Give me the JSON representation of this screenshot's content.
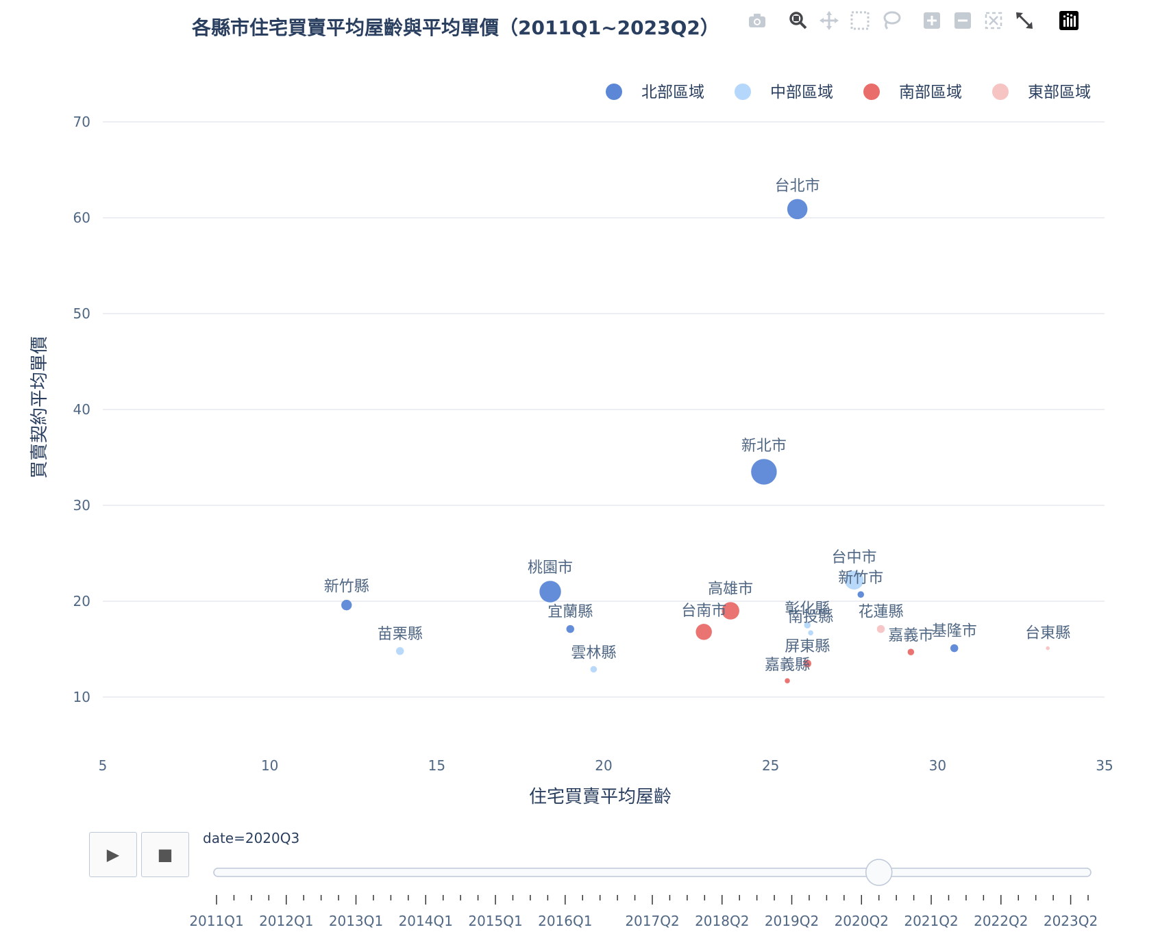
{
  "title": "各縣市住宅買賣平均屋齡與平均單價（2011Q1~2023Q2）",
  "modebar": {
    "icons": [
      "camera-icon",
      "zoom-icon",
      "pan-icon",
      "box-select-icon",
      "lasso-select-icon",
      "zoom-in-icon",
      "zoom-out-icon",
      "autoscale-icon",
      "reset-axes-icon",
      "plotly-logo-icon"
    ]
  },
  "legend": {
    "items": [
      {
        "label": "北部區域",
        "color": "#5b87d6"
      },
      {
        "label": "中部區域",
        "color": "#b5d7fb"
      },
      {
        "label": "南部區域",
        "color": "#e96d6a"
      },
      {
        "label": "東部區域",
        "color": "#f6c4c3"
      }
    ]
  },
  "animation": {
    "current_label": "date=2020Q3",
    "play_label": "▶",
    "stop_label": "■",
    "steps_total": 51,
    "current_step": 38,
    "tick_labels": [
      "2011Q1",
      "2012Q1",
      "2013Q1",
      "2014Q1",
      "2015Q1",
      "2016Q1",
      "2017Q2",
      "2018Q2",
      "2019Q2",
      "2020Q2",
      "2021Q2",
      "2022Q2",
      "2023Q2"
    ],
    "label_steps": [
      0,
      4,
      8,
      12,
      16,
      20,
      25,
      29,
      33,
      37,
      41,
      45,
      49
    ]
  },
  "chart_data": {
    "type": "scatter",
    "title": "各縣市住宅買賣平均屋齡與平均單價（2011Q1~2023Q2）",
    "xlabel": "住宅買賣平均屋齡",
    "ylabel": "買賣契約平均單價",
    "xlim": [
      5,
      35
    ],
    "ylim": [
      4.5,
      72
    ],
    "xticks": [
      5,
      10,
      15,
      20,
      25,
      30,
      35
    ],
    "yticks": [
      10,
      20,
      30,
      40,
      50,
      60,
      70
    ],
    "grid": true,
    "legend_position": "top-right",
    "frame": "2020Q3",
    "series": [
      {
        "name": "北部區域",
        "color": "#5b87d6",
        "points": [
          {
            "label": "台北市",
            "x": 25.8,
            "y": 60.9,
            "size": 15
          },
          {
            "label": "新北市",
            "x": 24.8,
            "y": 33.5,
            "size": 19
          },
          {
            "label": "桃園市",
            "x": 18.4,
            "y": 21.0,
            "size": 16
          },
          {
            "label": "新竹市",
            "x": 27.7,
            "y": 20.7,
            "size": 5
          },
          {
            "label": "新竹縣",
            "x": 12.3,
            "y": 19.6,
            "size": 8
          },
          {
            "label": "宜蘭縣",
            "x": 19.0,
            "y": 17.1,
            "size": 6
          },
          {
            "label": "基隆市",
            "x": 30.5,
            "y": 15.1,
            "size": 6
          }
        ]
      },
      {
        "name": "中部區域",
        "color": "#b5d7fb",
        "points": [
          {
            "label": "台中市",
            "x": 27.5,
            "y": 22.2,
            "size": 14
          },
          {
            "label": "彰化縣",
            "x": 26.1,
            "y": 17.5,
            "size": 5
          },
          {
            "label": "南投縣",
            "x": 26.2,
            "y": 16.7,
            "size": 4
          },
          {
            "label": "苗栗縣",
            "x": 13.9,
            "y": 14.8,
            "size": 6
          },
          {
            "label": "雲林縣",
            "x": 19.7,
            "y": 12.9,
            "size": 5
          }
        ]
      },
      {
        "name": "南部區域",
        "color": "#e96d6a",
        "points": [
          {
            "label": "高雄市",
            "x": 23.8,
            "y": 19.0,
            "size": 13
          },
          {
            "label": "台南市",
            "x": 23.0,
            "y": 16.8,
            "size": 12
          },
          {
            "label": "屏東縣",
            "x": 26.1,
            "y": 13.5,
            "size": 6
          },
          {
            "label": "嘉義市",
            "x": 29.2,
            "y": 14.7,
            "size": 5
          },
          {
            "label": "嘉義縣",
            "x": 25.5,
            "y": 11.7,
            "size": 4
          }
        ]
      },
      {
        "name": "東部區域",
        "color": "#f6c4c3",
        "points": [
          {
            "label": "花蓮縣",
            "x": 28.3,
            "y": 17.1,
            "size": 6
          },
          {
            "label": "台東縣",
            "x": 33.3,
            "y": 15.1,
            "size": 3
          }
        ]
      }
    ]
  }
}
